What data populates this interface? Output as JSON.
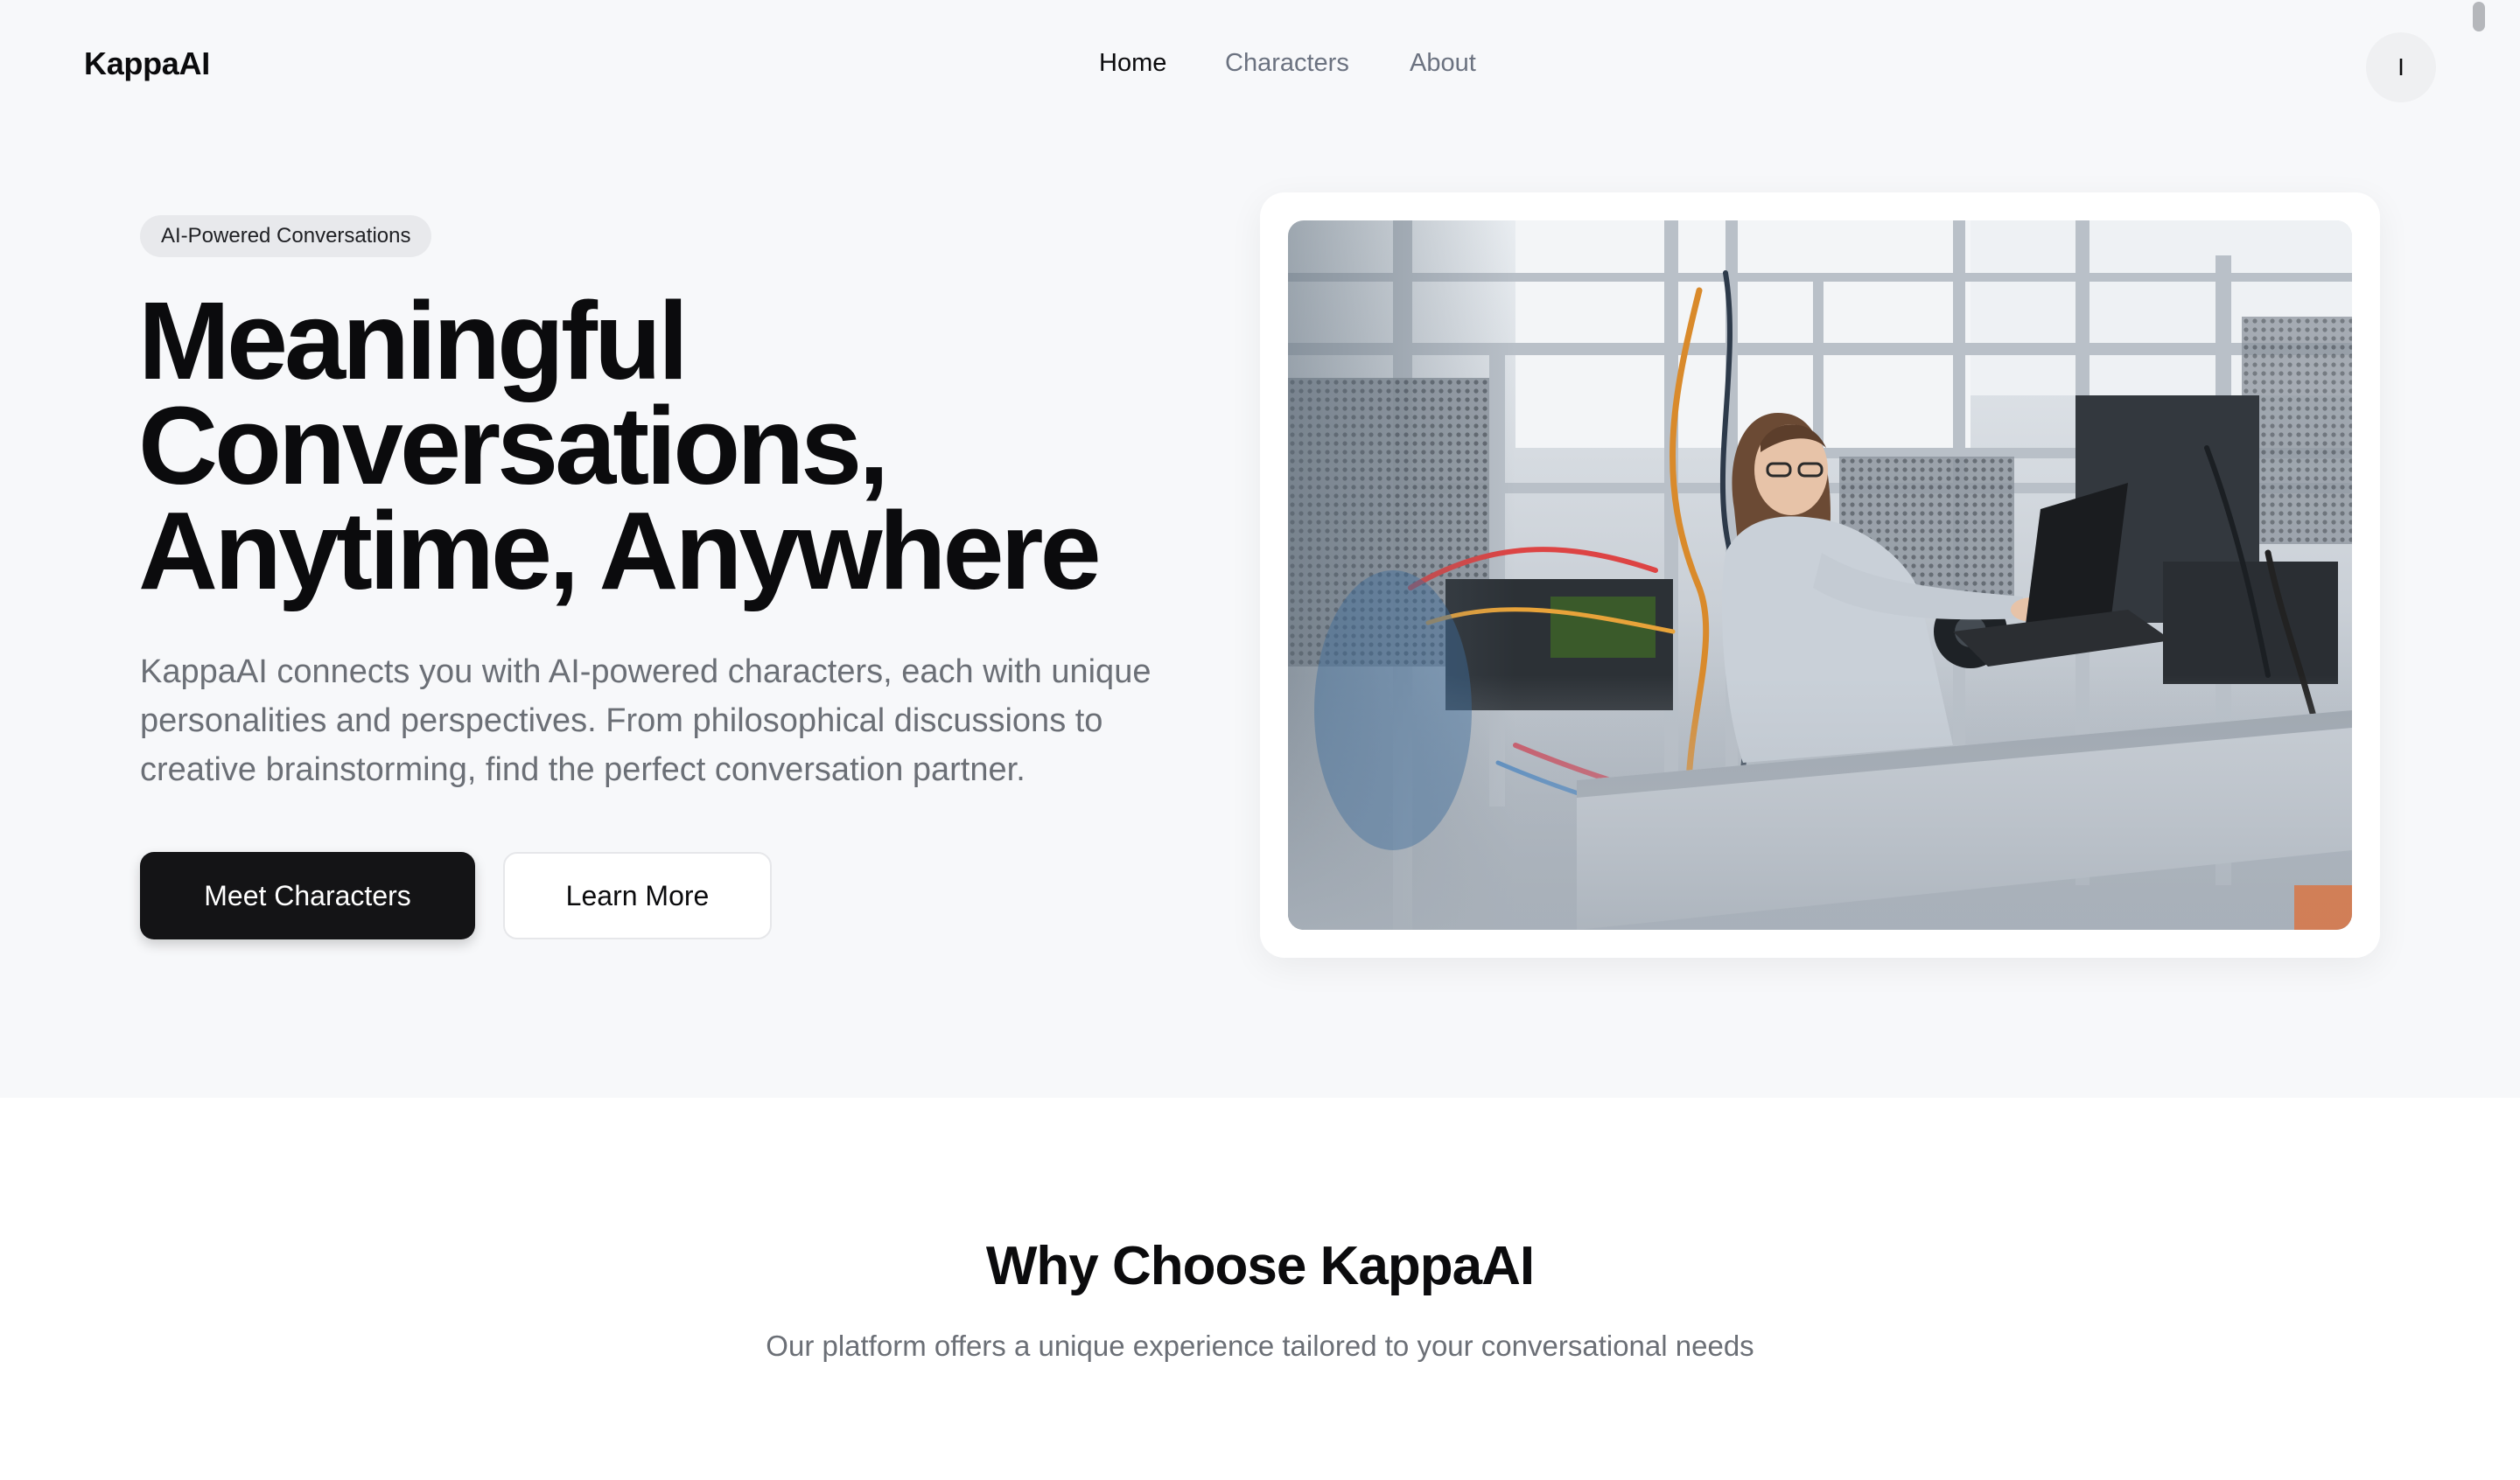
{
  "brand": {
    "name": "KappaAI"
  },
  "nav": {
    "items": [
      {
        "label": "Home",
        "active": true
      },
      {
        "label": "Characters",
        "active": false
      },
      {
        "label": "About",
        "active": false
      }
    ]
  },
  "user": {
    "avatar_initial": "I"
  },
  "hero": {
    "badge": "AI-Powered Conversations",
    "title_lines": [
      "Meaningful",
      "Conversations,",
      "Anytime, Anywhere"
    ],
    "description": "KappaAI connects you with AI-powered characters, each with unique personalities and perspectives. From philosophical discussions to creative brainstorming, find the perfect conversation partner.",
    "primary_button": "Meet Characters",
    "secondary_button": "Learn More"
  },
  "features": {
    "title": "Why Choose KappaAI",
    "subtitle": "Our platform offers a unique experience tailored to your conversational needs"
  },
  "colors": {
    "hero_background": "#f7f8fa",
    "primary_button": "#141416",
    "text_primary": "#0b0b0d",
    "text_muted": "#6b6f76"
  }
}
